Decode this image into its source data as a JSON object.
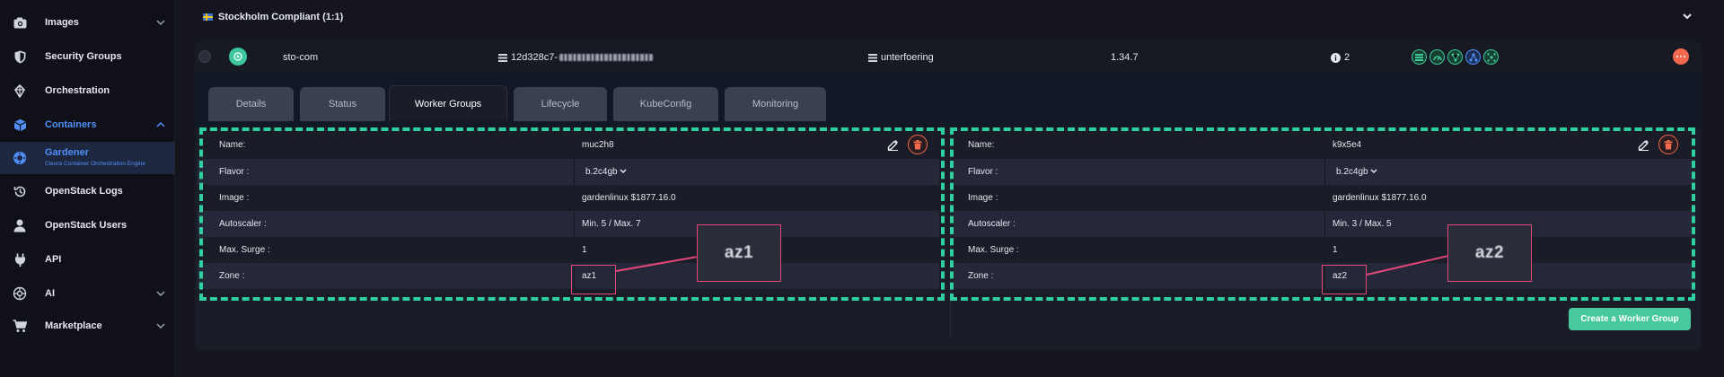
{
  "sidebar": {
    "items": [
      {
        "label": "Images",
        "icon": "camera-icon"
      },
      {
        "label": "Security Groups",
        "icon": "shield-icon"
      },
      {
        "label": "Orchestration",
        "icon": "orchestration-icon"
      },
      {
        "label": "Containers",
        "icon": "cube-icon"
      },
      {
        "label": "Gardener",
        "sublabel": "Cleura Container Orchestration Engine",
        "icon": "gardener-icon"
      },
      {
        "label": "OpenStack Logs",
        "icon": "history-icon"
      },
      {
        "label": "OpenStack Users",
        "icon": "user-icon"
      },
      {
        "label": "API",
        "icon": "plug-icon"
      },
      {
        "label": "AI",
        "icon": "ai-icon"
      },
      {
        "label": "Marketplace",
        "icon": "cart-icon"
      }
    ]
  },
  "region": {
    "title": "Stockholm Compliant (1:1)"
  },
  "cluster": {
    "name": "sto-com",
    "id_prefix": "12d328c7-",
    "project": "unterfoering",
    "version": "1.34.7",
    "info_count": "2"
  },
  "tabs": [
    "Details",
    "Status",
    "Worker Groups",
    "Lifecycle",
    "KubeConfig",
    "Monitoring"
  ],
  "active_tab": "Worker Groups",
  "labels": {
    "name": "Name:",
    "flavor": "Flavor :",
    "image": "Image :",
    "autoscaler": "Autoscaler :",
    "max_surge": "Max. Surge :",
    "zone": "Zone :"
  },
  "worker_groups": [
    {
      "name": "muc2h8",
      "flavor": "b.2c4gb",
      "image": "gardenlinux $1877.16.0",
      "autoscaler": "Min. 5 / Max. 7",
      "max_surge": "1",
      "zone": "az1",
      "zoom_label": "az1"
    },
    {
      "name": "k9x5e4",
      "flavor": "b.2c4gb",
      "image": "gardenlinux $1877.16.0",
      "autoscaler": "Min. 3 / Max. 5",
      "max_surge": "1",
      "zone": "az2",
      "zoom_label": "az2"
    }
  ],
  "create_button": "Create a Worker Group",
  "colors": {
    "accent_blue": "#4f8ff7",
    "highlight_green": "#2fcf9f",
    "annotation_pink": "#e5477a",
    "danger": "#f2694e",
    "create_button": "#48c99c"
  }
}
